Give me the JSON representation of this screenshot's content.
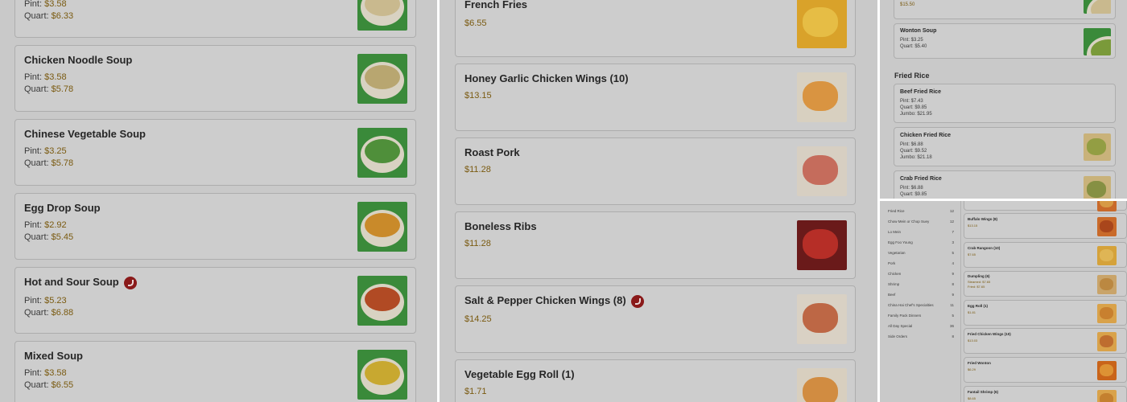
{
  "panel1": {
    "items": [
      {
        "name": "",
        "lines": [
          {
            "label": "Pint:",
            "price": "$3.58"
          },
          {
            "label": "Quart:",
            "price": "$6.33"
          }
        ],
        "thumb": "soup-bowl"
      },
      {
        "name": "Chicken Noodle Soup",
        "lines": [
          {
            "label": "Pint:",
            "price": "$3.58"
          },
          {
            "label": "Quart:",
            "price": "$5.78"
          }
        ],
        "thumb": "soup-bowl"
      },
      {
        "name": "Chinese Vegetable Soup",
        "lines": [
          {
            "label": "Pint:",
            "price": "$3.25"
          },
          {
            "label": "Quart:",
            "price": "$5.78"
          }
        ],
        "thumb": "soup-bowl"
      },
      {
        "name": "Egg Drop Soup",
        "lines": [
          {
            "label": "Pint:",
            "price": "$2.92"
          },
          {
            "label": "Quart:",
            "price": "$5.45"
          }
        ],
        "thumb": "soup-bowl"
      },
      {
        "name": "Hot and Sour Soup",
        "spicy": true,
        "lines": [
          {
            "label": "Pint:",
            "price": "$5.23"
          },
          {
            "label": "Quart:",
            "price": "$6.88"
          }
        ],
        "thumb": "soup-bowl"
      },
      {
        "name": "Mixed Soup",
        "lines": [
          {
            "label": "Pint:",
            "price": "$3.58"
          },
          {
            "label": "Quart:",
            "price": "$6.55"
          }
        ],
        "thumb": "soup-bowl"
      }
    ]
  },
  "panel2": {
    "items": [
      {
        "name": "French Fries",
        "price": "$6.55"
      },
      {
        "name": "Honey Garlic Chicken Wings (10)",
        "price": "$13.15"
      },
      {
        "name": "Roast Pork",
        "price": "$11.28"
      },
      {
        "name": "Boneless Ribs",
        "price": "$11.28"
      },
      {
        "name": "Salt & Pepper Chicken Wings (8)",
        "spicy": true,
        "price": "$14.25"
      },
      {
        "name": "Vegetable Egg Roll (1)",
        "price": "$1.71"
      }
    ]
  },
  "panel3": {
    "top_price": "$15.50",
    "wonton": {
      "name": "Wonton Soup",
      "lines": [
        "Pint: $3.25",
        "Quart: $5.40"
      ]
    },
    "section_title": "Fried Rice",
    "items": [
      {
        "name": "Beef Fried Rice",
        "lines": [
          "Pint: $7.43",
          "Quart: $9.85",
          "Jumbo: $21.95"
        ]
      },
      {
        "name": "Chicken Fried Rice",
        "lines": [
          "Pint: $6.88",
          "Quart: $9.52",
          "Jumbo: $21.18"
        ]
      },
      {
        "name": "Crab Fried Rice",
        "lines": [
          "Pint: $6.88",
          "Quart: $9.85"
        ]
      }
    ]
  },
  "panel4": {
    "categories": [
      {
        "label": "Fried Rice",
        "count": "12"
      },
      {
        "label": "Chow Mein or Chop Suey",
        "count": "12"
      },
      {
        "label": "Lo Mein",
        "count": "7"
      },
      {
        "label": "Egg Foo Young",
        "count": "3"
      },
      {
        "label": "Vegetarian",
        "count": "5"
      },
      {
        "label": "Pork",
        "count": "4"
      },
      {
        "label": "Chicken",
        "count": "9"
      },
      {
        "label": "Shrimp",
        "count": "8"
      },
      {
        "label": "Beef",
        "count": "9"
      },
      {
        "label": "China Hai Chef's Specialties",
        "count": "11"
      },
      {
        "label": "Family Pack Dinners",
        "count": "5"
      },
      {
        "label": "All Day Special",
        "count": "36"
      },
      {
        "label": "Side Orders",
        "count": "8"
      }
    ],
    "items": [
      {
        "name": "Buffalo Wings (8)",
        "lines": [
          "$13.15"
        ]
      },
      {
        "name": "Crab Rangoon (10)",
        "lines": [
          "$7.65"
        ]
      },
      {
        "name": "Dumpling (6)",
        "lines": [
          "Steamed: $7.65",
          "Fried: $7.65"
        ]
      },
      {
        "name": "Egg Roll (1)",
        "lines": [
          "$1.81"
        ]
      },
      {
        "name": "Fried Chicken Wings (10)",
        "lines": [
          "$13.03"
        ]
      },
      {
        "name": "Fried Wonton",
        "lines": [
          "$6.29"
        ]
      },
      {
        "name": "Fantail Shrimp (6)",
        "lines": [
          "$8.65"
        ]
      }
    ]
  }
}
